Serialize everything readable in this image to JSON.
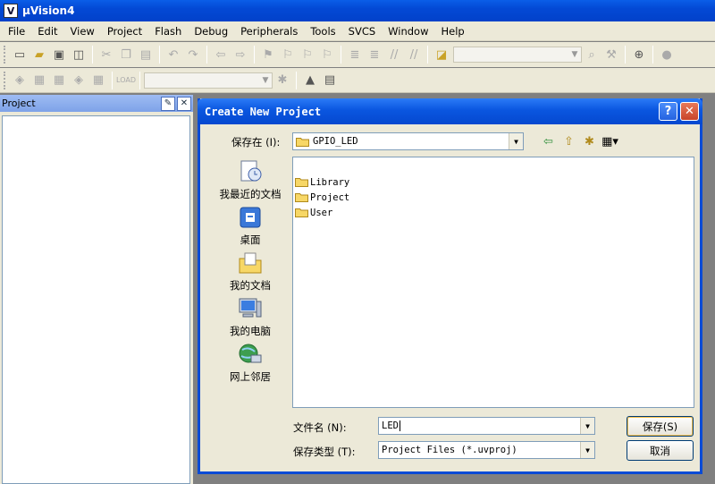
{
  "app": {
    "title": "µVision4"
  },
  "menu": [
    "File",
    "Edit",
    "View",
    "Project",
    "Flash",
    "Debug",
    "Peripherals",
    "Tools",
    "SVCS",
    "Window",
    "Help"
  ],
  "project_pane": {
    "title": "Project"
  },
  "dialog": {
    "title": "Create New Project",
    "look_in_label": "保存在 (I):",
    "look_in_value": "GPIO_LED",
    "places": [
      "我最近的文档",
      "桌面",
      "我的文档",
      "我的电脑",
      "网上邻居"
    ],
    "files": [
      "Library",
      "Project",
      "User"
    ],
    "file_name_label": "文件名 (N):",
    "file_name_value": "LED",
    "file_type_label": "保存类型 (T):",
    "file_type_value": "Project Files (*.uvproj)",
    "save_button": "保存(S)",
    "cancel_button": "取消"
  },
  "colors": {
    "titlebar": "#0349d5",
    "dialog_title": "#0a56e0",
    "face": "#ece9d8",
    "mdi": "#808080"
  }
}
